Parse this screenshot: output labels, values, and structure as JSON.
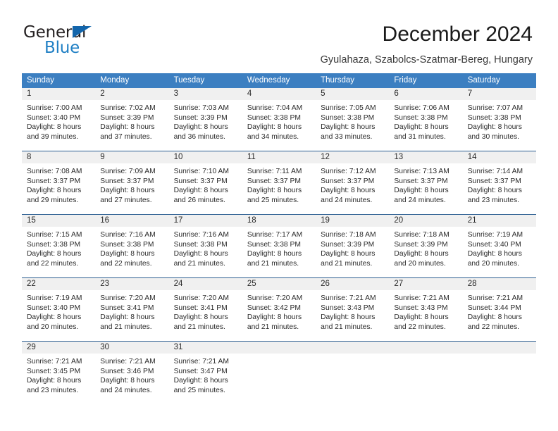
{
  "logo": {
    "text_top": "General",
    "text_bottom": "Blue",
    "triangle_color": "#1265ab",
    "blue_color": "#1f7fc4"
  },
  "header": {
    "title": "December 2024",
    "subtitle": "Gyulahaza, Szabolcs-Szatmar-Bereg, Hungary"
  },
  "colors": {
    "header_blue": "#3c7fc1",
    "week_rule": "#2d5f92",
    "numband_gray": "#f0f0f0"
  },
  "weekdays": [
    "Sunday",
    "Monday",
    "Tuesday",
    "Wednesday",
    "Thursday",
    "Friday",
    "Saturday"
  ],
  "weeks": [
    [
      {
        "day": "1",
        "sunrise": "Sunrise: 7:00 AM",
        "sunset": "Sunset: 3:40 PM",
        "daylight1": "Daylight: 8 hours",
        "daylight2": "and 39 minutes."
      },
      {
        "day": "2",
        "sunrise": "Sunrise: 7:02 AM",
        "sunset": "Sunset: 3:39 PM",
        "daylight1": "Daylight: 8 hours",
        "daylight2": "and 37 minutes."
      },
      {
        "day": "3",
        "sunrise": "Sunrise: 7:03 AM",
        "sunset": "Sunset: 3:39 PM",
        "daylight1": "Daylight: 8 hours",
        "daylight2": "and 36 minutes."
      },
      {
        "day": "4",
        "sunrise": "Sunrise: 7:04 AM",
        "sunset": "Sunset: 3:38 PM",
        "daylight1": "Daylight: 8 hours",
        "daylight2": "and 34 minutes."
      },
      {
        "day": "5",
        "sunrise": "Sunrise: 7:05 AM",
        "sunset": "Sunset: 3:38 PM",
        "daylight1": "Daylight: 8 hours",
        "daylight2": "and 33 minutes."
      },
      {
        "day": "6",
        "sunrise": "Sunrise: 7:06 AM",
        "sunset": "Sunset: 3:38 PM",
        "daylight1": "Daylight: 8 hours",
        "daylight2": "and 31 minutes."
      },
      {
        "day": "7",
        "sunrise": "Sunrise: 7:07 AM",
        "sunset": "Sunset: 3:38 PM",
        "daylight1": "Daylight: 8 hours",
        "daylight2": "and 30 minutes."
      }
    ],
    [
      {
        "day": "8",
        "sunrise": "Sunrise: 7:08 AM",
        "sunset": "Sunset: 3:37 PM",
        "daylight1": "Daylight: 8 hours",
        "daylight2": "and 29 minutes."
      },
      {
        "day": "9",
        "sunrise": "Sunrise: 7:09 AM",
        "sunset": "Sunset: 3:37 PM",
        "daylight1": "Daylight: 8 hours",
        "daylight2": "and 27 minutes."
      },
      {
        "day": "10",
        "sunrise": "Sunrise: 7:10 AM",
        "sunset": "Sunset: 3:37 PM",
        "daylight1": "Daylight: 8 hours",
        "daylight2": "and 26 minutes."
      },
      {
        "day": "11",
        "sunrise": "Sunrise: 7:11 AM",
        "sunset": "Sunset: 3:37 PM",
        "daylight1": "Daylight: 8 hours",
        "daylight2": "and 25 minutes."
      },
      {
        "day": "12",
        "sunrise": "Sunrise: 7:12 AM",
        "sunset": "Sunset: 3:37 PM",
        "daylight1": "Daylight: 8 hours",
        "daylight2": "and 24 minutes."
      },
      {
        "day": "13",
        "sunrise": "Sunrise: 7:13 AM",
        "sunset": "Sunset: 3:37 PM",
        "daylight1": "Daylight: 8 hours",
        "daylight2": "and 24 minutes."
      },
      {
        "day": "14",
        "sunrise": "Sunrise: 7:14 AM",
        "sunset": "Sunset: 3:37 PM",
        "daylight1": "Daylight: 8 hours",
        "daylight2": "and 23 minutes."
      }
    ],
    [
      {
        "day": "15",
        "sunrise": "Sunrise: 7:15 AM",
        "sunset": "Sunset: 3:38 PM",
        "daylight1": "Daylight: 8 hours",
        "daylight2": "and 22 minutes."
      },
      {
        "day": "16",
        "sunrise": "Sunrise: 7:16 AM",
        "sunset": "Sunset: 3:38 PM",
        "daylight1": "Daylight: 8 hours",
        "daylight2": "and 22 minutes."
      },
      {
        "day": "17",
        "sunrise": "Sunrise: 7:16 AM",
        "sunset": "Sunset: 3:38 PM",
        "daylight1": "Daylight: 8 hours",
        "daylight2": "and 21 minutes."
      },
      {
        "day": "18",
        "sunrise": "Sunrise: 7:17 AM",
        "sunset": "Sunset: 3:38 PM",
        "daylight1": "Daylight: 8 hours",
        "daylight2": "and 21 minutes."
      },
      {
        "day": "19",
        "sunrise": "Sunrise: 7:18 AM",
        "sunset": "Sunset: 3:39 PM",
        "daylight1": "Daylight: 8 hours",
        "daylight2": "and 21 minutes."
      },
      {
        "day": "20",
        "sunrise": "Sunrise: 7:18 AM",
        "sunset": "Sunset: 3:39 PM",
        "daylight1": "Daylight: 8 hours",
        "daylight2": "and 20 minutes."
      },
      {
        "day": "21",
        "sunrise": "Sunrise: 7:19 AM",
        "sunset": "Sunset: 3:40 PM",
        "daylight1": "Daylight: 8 hours",
        "daylight2": "and 20 minutes."
      }
    ],
    [
      {
        "day": "22",
        "sunrise": "Sunrise: 7:19 AM",
        "sunset": "Sunset: 3:40 PM",
        "daylight1": "Daylight: 8 hours",
        "daylight2": "and 20 minutes."
      },
      {
        "day": "23",
        "sunrise": "Sunrise: 7:20 AM",
        "sunset": "Sunset: 3:41 PM",
        "daylight1": "Daylight: 8 hours",
        "daylight2": "and 21 minutes."
      },
      {
        "day": "24",
        "sunrise": "Sunrise: 7:20 AM",
        "sunset": "Sunset: 3:41 PM",
        "daylight1": "Daylight: 8 hours",
        "daylight2": "and 21 minutes."
      },
      {
        "day": "25",
        "sunrise": "Sunrise: 7:20 AM",
        "sunset": "Sunset: 3:42 PM",
        "daylight1": "Daylight: 8 hours",
        "daylight2": "and 21 minutes."
      },
      {
        "day": "26",
        "sunrise": "Sunrise: 7:21 AM",
        "sunset": "Sunset: 3:43 PM",
        "daylight1": "Daylight: 8 hours",
        "daylight2": "and 21 minutes."
      },
      {
        "day": "27",
        "sunrise": "Sunrise: 7:21 AM",
        "sunset": "Sunset: 3:43 PM",
        "daylight1": "Daylight: 8 hours",
        "daylight2": "and 22 minutes."
      },
      {
        "day": "28",
        "sunrise": "Sunrise: 7:21 AM",
        "sunset": "Sunset: 3:44 PM",
        "daylight1": "Daylight: 8 hours",
        "daylight2": "and 22 minutes."
      }
    ],
    [
      {
        "day": "29",
        "sunrise": "Sunrise: 7:21 AM",
        "sunset": "Sunset: 3:45 PM",
        "daylight1": "Daylight: 8 hours",
        "daylight2": "and 23 minutes."
      },
      {
        "day": "30",
        "sunrise": "Sunrise: 7:21 AM",
        "sunset": "Sunset: 3:46 PM",
        "daylight1": "Daylight: 8 hours",
        "daylight2": "and 24 minutes."
      },
      {
        "day": "31",
        "sunrise": "Sunrise: 7:21 AM",
        "sunset": "Sunset: 3:47 PM",
        "daylight1": "Daylight: 8 hours",
        "daylight2": "and 25 minutes."
      },
      {
        "day": "",
        "sunrise": "",
        "sunset": "",
        "daylight1": "",
        "daylight2": ""
      },
      {
        "day": "",
        "sunrise": "",
        "sunset": "",
        "daylight1": "",
        "daylight2": ""
      },
      {
        "day": "",
        "sunrise": "",
        "sunset": "",
        "daylight1": "",
        "daylight2": ""
      },
      {
        "day": "",
        "sunrise": "",
        "sunset": "",
        "daylight1": "",
        "daylight2": ""
      }
    ]
  ]
}
